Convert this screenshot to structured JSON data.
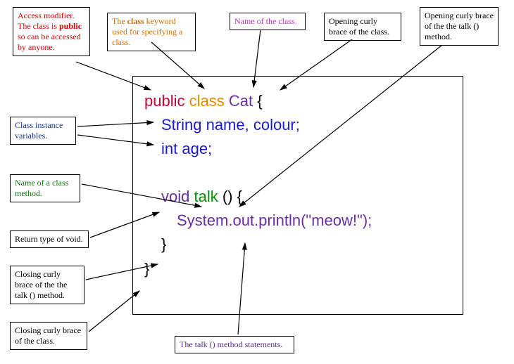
{
  "code": {
    "public": "public",
    "class": "class",
    "cat": "Cat",
    "brace_open": "{",
    "line_string": "String name, colour;",
    "line_int": "int age;",
    "void": "void",
    "talk": "talk",
    "talk_parens": "() {",
    "stmt": "System.out.println(\"meow!\");",
    "brace_close1": "}",
    "brace_close2": "}"
  },
  "labels": {
    "access": {
      "pre": "Access modifier. The class is ",
      "bold": "public",
      "post": " so can be accessed by anyone."
    },
    "classkw": {
      "pre": "The ",
      "bold": "class",
      "post": " keyword used for specifying a class."
    },
    "classname": "Name of the class.",
    "openbrace_class": "Opening curly brace of the class.",
    "openbrace_talk": "Opening curly brace of the the talk () method.",
    "instvars": "Class instance variables.",
    "methodname": "Name of a class method.",
    "returntype": "Return type of void.",
    "closing_talk": "Closing curly brace of the the talk () method.",
    "closing_class": "Closing curly brace of the class.",
    "talkstmts": "The talk () method statements."
  }
}
